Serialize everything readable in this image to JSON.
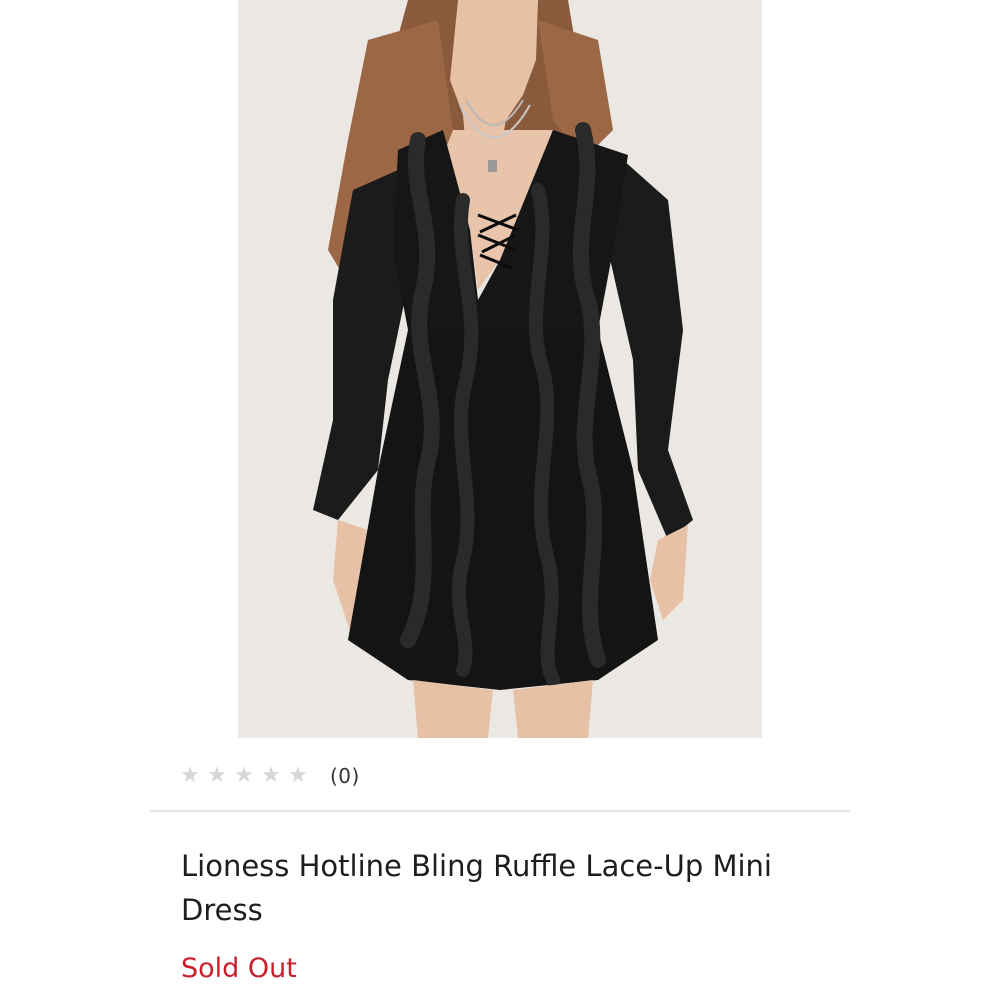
{
  "product": {
    "image_alt": "Model wearing black long-sleeve ruffle lace-up mini dress",
    "rating": {
      "stars_filled": 0,
      "stars_total": 5,
      "review_count_label": "(0)",
      "star_color": "#d7d7d7"
    },
    "title": "Lioness Hotline Bling Ruffle Lace-Up Mini Dress",
    "status": "Sold Out",
    "status_color": "#c8202c"
  }
}
